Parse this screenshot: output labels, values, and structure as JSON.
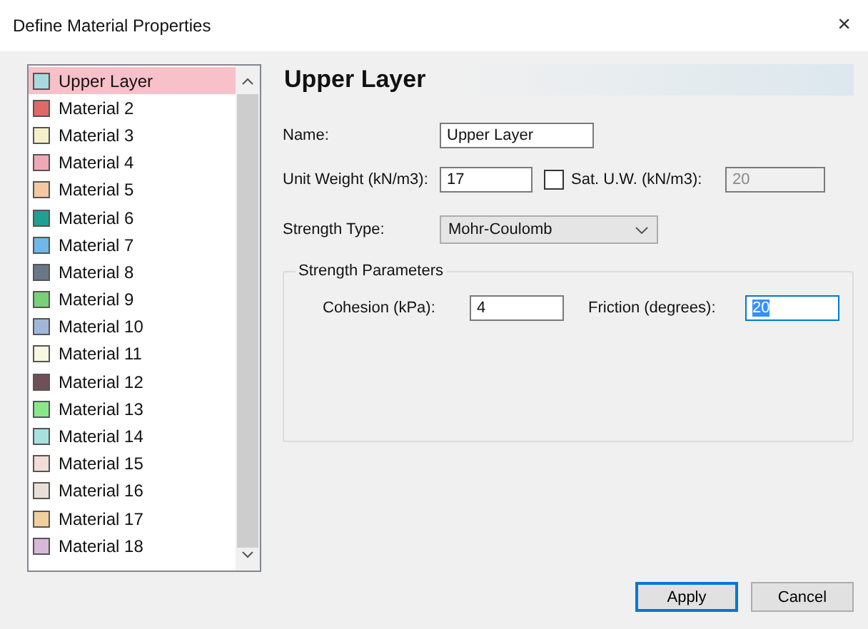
{
  "window": {
    "title": "Define Material Properties",
    "close": "×"
  },
  "materials": [
    {
      "name": "Upper Layer",
      "color": "#a8d8e0",
      "selected": true
    },
    {
      "name": "Material 2",
      "color": "#e06868",
      "selected": false
    },
    {
      "name": "Material 3",
      "color": "#f4f0c8",
      "selected": false
    },
    {
      "name": "Material 4",
      "color": "#f0a8b4",
      "selected": false
    },
    {
      "name": "Material 5",
      "color": "#f4c8a0",
      "selected": false
    },
    {
      "name": "Material 6",
      "color": "#20a090",
      "selected": false
    },
    {
      "name": "Material 7",
      "color": "#70b8e8",
      "selected": false
    },
    {
      "name": "Material 8",
      "color": "#687888",
      "selected": false
    },
    {
      "name": "Material 9",
      "color": "#78d078",
      "selected": false
    },
    {
      "name": "Material 10",
      "color": "#a0b8d8",
      "selected": false
    },
    {
      "name": "Material 11",
      "color": "#f8f8e0",
      "selected": false
    },
    {
      "name": "Material 12",
      "color": "#705058",
      "selected": false
    },
    {
      "name": "Material 13",
      "color": "#88e888",
      "selected": false
    },
    {
      "name": "Material 14",
      "color": "#a8e0e0",
      "selected": false
    },
    {
      "name": "Material 15",
      "color": "#f4dcd8",
      "selected": false
    },
    {
      "name": "Material 16",
      "color": "#e8e0d8",
      "selected": false
    },
    {
      "name": "Material 17",
      "color": "#f0d0a0",
      "selected": false
    },
    {
      "name": "Material 18",
      "color": "#d8b8d8",
      "selected": false
    }
  ],
  "header": "Upper Layer",
  "name": {
    "label": "Name:",
    "value": "Upper Layer"
  },
  "unit_weight": {
    "label": "Unit Weight (kN/m3):",
    "value": "17"
  },
  "sat_uw": {
    "label": "Sat. U.W. (kN/m3):",
    "checked": false,
    "value": "20"
  },
  "strength_type": {
    "label": "Strength Type:",
    "value": "Mohr-Coulomb"
  },
  "strength_parameters": {
    "title": "Strength Parameters",
    "cohesion": {
      "label": "Cohesion (kPa):",
      "value": "4",
      "focused": false
    },
    "friction": {
      "label": "Friction (degrees):",
      "value": "20",
      "focused": true
    }
  },
  "buttons": [
    {
      "label": "Apply",
      "default": true
    },
    {
      "label": "Cancel",
      "default": false
    }
  ]
}
